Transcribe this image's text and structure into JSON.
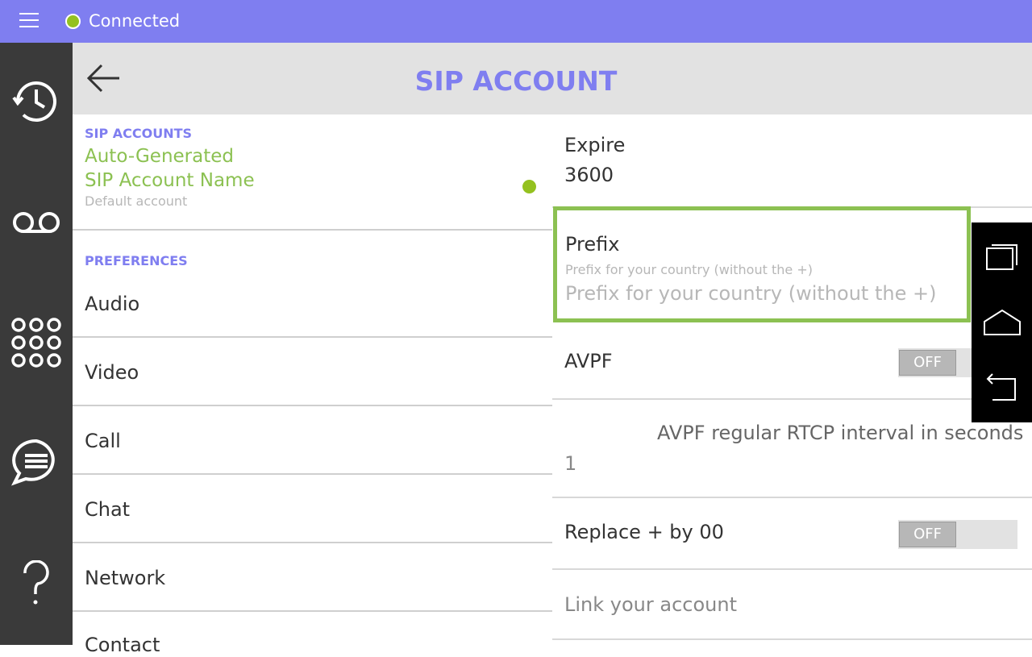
{
  "topbar": {
    "status_text": "Connected",
    "status_color": "#94c11f",
    "bg_color": "#7f7ef0"
  },
  "leftnav": {
    "items": [
      {
        "icon": "history-icon"
      },
      {
        "icon": "voicemail-icon"
      },
      {
        "icon": "dialpad-icon"
      },
      {
        "icon": "chat-icon"
      },
      {
        "icon": "help-icon"
      }
    ]
  },
  "header": {
    "title": "SIP ACCOUNT"
  },
  "left": {
    "sip_section_label": "SIP ACCOUNTS",
    "account_line1": "Auto-Generated",
    "account_line2": "SIP Account Name",
    "account_sub": "Default account",
    "preferences_label": "PREFERENCES",
    "pref_items": [
      "Audio",
      "Video",
      "Call",
      "Chat",
      "Network",
      "Contact"
    ]
  },
  "right": {
    "expire_label": "Expire",
    "expire_value": "3600",
    "prefix_label": "Prefix",
    "prefix_hint": "Prefix for your country (without the +)",
    "prefix_placeholder": "Prefix for your country (without the +)",
    "prefix_value": "",
    "avpf_label": "AVPF",
    "avpf_toggle": "OFF",
    "avpf_interval_label": "AVPF regular RTCP interval in seconds",
    "avpf_interval_value": "1",
    "replace_label": "Replace + by 00",
    "replace_toggle": "OFF",
    "link_account": "Link your account"
  },
  "sysnav": {
    "items": [
      "recent-apps-icon",
      "home-icon",
      "back-icon"
    ]
  },
  "colors": {
    "accent": "#7f7ef0",
    "green": "#8cc152",
    "sidebar": "#3a3a3a"
  }
}
